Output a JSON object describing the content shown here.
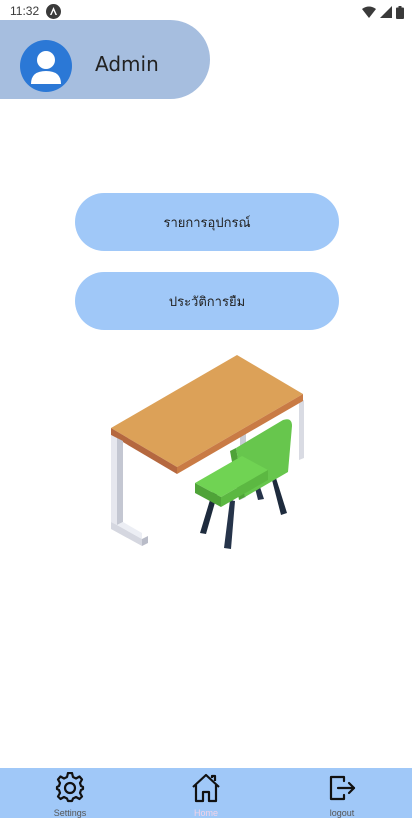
{
  "status_bar": {
    "time": "11:32"
  },
  "profile": {
    "name": "Admin"
  },
  "menu": {
    "equipment_list_label": "รายการอุปกรณ์",
    "borrow_history_label": "ประวัติการยืม"
  },
  "illustration": {
    "name": "desk-and-chair"
  },
  "bottom_nav": {
    "items": [
      {
        "label": "Settings",
        "icon": "gear-icon",
        "active": false
      },
      {
        "label": "Home",
        "icon": "home-icon",
        "active": true
      },
      {
        "label": "logout",
        "icon": "logout-icon",
        "active": false
      }
    ]
  },
  "colors": {
    "profile_pill": "#a6bedf",
    "avatar": "#2b78d6",
    "button": "#a0c8f8",
    "nav_bar": "#a0c8f8",
    "active_label": "#f0d3e8"
  }
}
